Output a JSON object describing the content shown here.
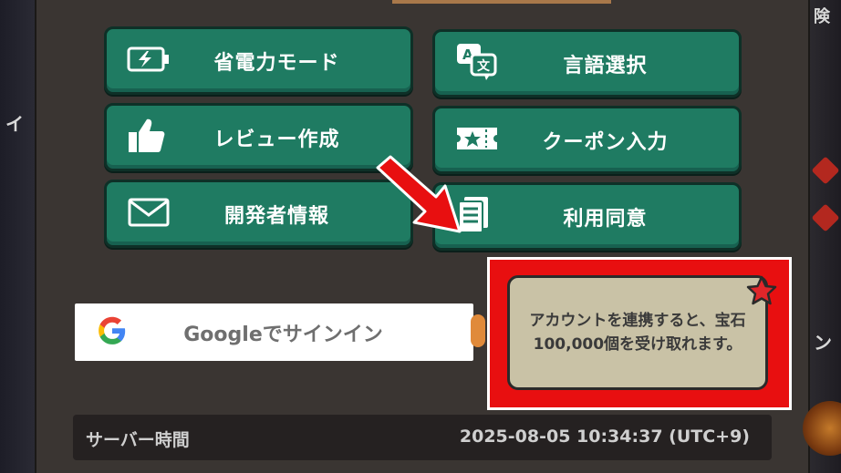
{
  "menu": {
    "buttons": [
      {
        "id": "power-save",
        "label": "省電力モード",
        "icon": "battery-icon"
      },
      {
        "id": "language",
        "label": "言語選択",
        "icon": "translate-icon"
      },
      {
        "id": "review",
        "label": "レビュー作成",
        "icon": "thumbs-up-icon"
      },
      {
        "id": "coupon",
        "label": "クーポン入力",
        "icon": "ticket-icon"
      },
      {
        "id": "developer",
        "label": "開発者情報",
        "icon": "envelope-icon"
      },
      {
        "id": "terms",
        "label": "利用同意",
        "icon": "document-icon"
      }
    ]
  },
  "google": {
    "label": "Googleでサインイン",
    "icon": "google-g-icon"
  },
  "callout": {
    "text": "アカウントを連携すると、宝石100,000個を受け取れます。",
    "highlight_color": "#e80f10"
  },
  "server": {
    "label": "サーバー時間",
    "time": "2025-08-05 10:34:37 (UTC+9)"
  },
  "side": {
    "right_top_char": "険",
    "left_char": "イ",
    "right_char": "ン"
  },
  "colors": {
    "button_green": "#1f7b62",
    "panel_brown": "#3a3532",
    "arrow_red": "#e80f10"
  }
}
